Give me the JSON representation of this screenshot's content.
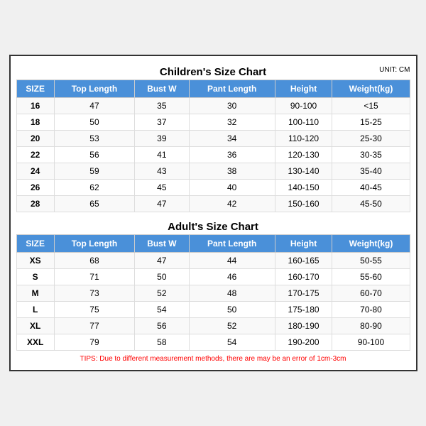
{
  "children_title": "Children's Size Chart",
  "adults_title": "Adult's Size Chart",
  "unit": "UNIT: CM",
  "headers": [
    "SIZE",
    "Top Length",
    "Bust W",
    "Pant Length",
    "Height",
    "Weight(kg)"
  ],
  "children_rows": [
    [
      "16",
      "47",
      "35",
      "30",
      "90-100",
      "<15"
    ],
    [
      "18",
      "50",
      "37",
      "32",
      "100-110",
      "15-25"
    ],
    [
      "20",
      "53",
      "39",
      "34",
      "110-120",
      "25-30"
    ],
    [
      "22",
      "56",
      "41",
      "36",
      "120-130",
      "30-35"
    ],
    [
      "24",
      "59",
      "43",
      "38",
      "130-140",
      "35-40"
    ],
    [
      "26",
      "62",
      "45",
      "40",
      "140-150",
      "40-45"
    ],
    [
      "28",
      "65",
      "47",
      "42",
      "150-160",
      "45-50"
    ]
  ],
  "adult_rows": [
    [
      "XS",
      "68",
      "47",
      "44",
      "160-165",
      "50-55"
    ],
    [
      "S",
      "71",
      "50",
      "46",
      "160-170",
      "55-60"
    ],
    [
      "M",
      "73",
      "52",
      "48",
      "170-175",
      "60-70"
    ],
    [
      "L",
      "75",
      "54",
      "50",
      "175-180",
      "70-80"
    ],
    [
      "XL",
      "77",
      "56",
      "52",
      "180-190",
      "80-90"
    ],
    [
      "XXL",
      "79",
      "58",
      "54",
      "190-200",
      "90-100"
    ]
  ],
  "tips": "TIPS: Due to different measurement methods, there are may be an error of 1cm-3cm"
}
